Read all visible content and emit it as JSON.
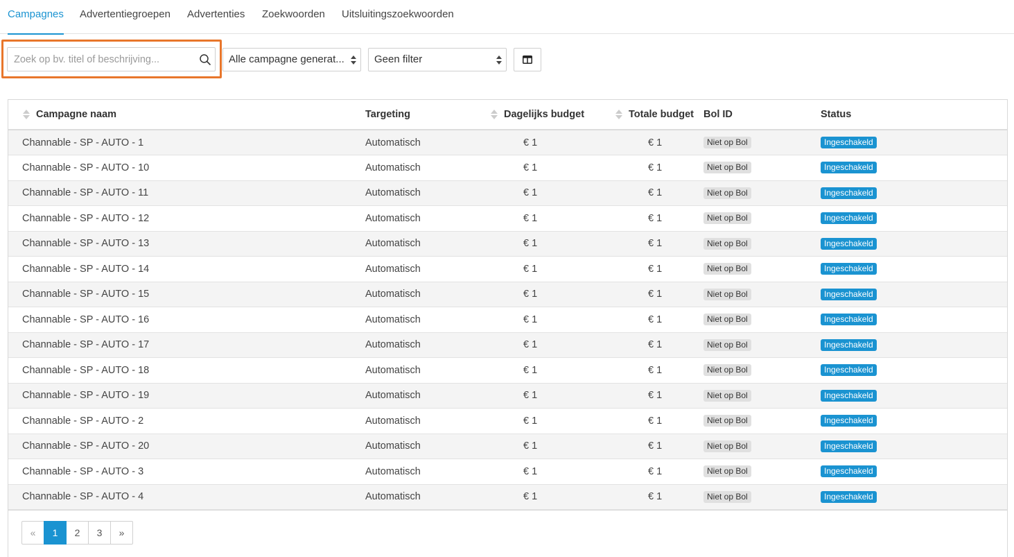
{
  "tabs": [
    {
      "label": "Campagnes",
      "active": true
    },
    {
      "label": "Advertentiegroepen"
    },
    {
      "label": "Advertenties"
    },
    {
      "label": "Zoekwoorden"
    },
    {
      "label": "Uitsluitingszoekwoorden"
    }
  ],
  "toolbar": {
    "search_placeholder": "Zoek op bv. titel of beschrijving...",
    "generator_select": "Alle campagne generat...",
    "filter_select": "Geen filter"
  },
  "table": {
    "columns": [
      "Campagne naam",
      "Targeting",
      "Dagelijks budget",
      "Totale budget",
      "Bol ID",
      "Status"
    ],
    "rows": [
      {
        "name": "Channable - SP - AUTO - 1",
        "targeting": "Automatisch",
        "daily": "€ 1",
        "total": "€ 1",
        "bol": "Niet op Bol",
        "status": "Ingeschakeld"
      },
      {
        "name": "Channable - SP - AUTO - 10",
        "targeting": "Automatisch",
        "daily": "€ 1",
        "total": "€ 1",
        "bol": "Niet op Bol",
        "status": "Ingeschakeld"
      },
      {
        "name": "Channable - SP - AUTO - 11",
        "targeting": "Automatisch",
        "daily": "€ 1",
        "total": "€ 1",
        "bol": "Niet op Bol",
        "status": "Ingeschakeld"
      },
      {
        "name": "Channable - SP - AUTO - 12",
        "targeting": "Automatisch",
        "daily": "€ 1",
        "total": "€ 1",
        "bol": "Niet op Bol",
        "status": "Ingeschakeld"
      },
      {
        "name": "Channable - SP - AUTO - 13",
        "targeting": "Automatisch",
        "daily": "€ 1",
        "total": "€ 1",
        "bol": "Niet op Bol",
        "status": "Ingeschakeld"
      },
      {
        "name": "Channable - SP - AUTO - 14",
        "targeting": "Automatisch",
        "daily": "€ 1",
        "total": "€ 1",
        "bol": "Niet op Bol",
        "status": "Ingeschakeld"
      },
      {
        "name": "Channable - SP - AUTO - 15",
        "targeting": "Automatisch",
        "daily": "€ 1",
        "total": "€ 1",
        "bol": "Niet op Bol",
        "status": "Ingeschakeld"
      },
      {
        "name": "Channable - SP - AUTO - 16",
        "targeting": "Automatisch",
        "daily": "€ 1",
        "total": "€ 1",
        "bol": "Niet op Bol",
        "status": "Ingeschakeld"
      },
      {
        "name": "Channable - SP - AUTO - 17",
        "targeting": "Automatisch",
        "daily": "€ 1",
        "total": "€ 1",
        "bol": "Niet op Bol",
        "status": "Ingeschakeld"
      },
      {
        "name": "Channable - SP - AUTO - 18",
        "targeting": "Automatisch",
        "daily": "€ 1",
        "total": "€ 1",
        "bol": "Niet op Bol",
        "status": "Ingeschakeld"
      },
      {
        "name": "Channable - SP - AUTO - 19",
        "targeting": "Automatisch",
        "daily": "€ 1",
        "total": "€ 1",
        "bol": "Niet op Bol",
        "status": "Ingeschakeld"
      },
      {
        "name": "Channable - SP - AUTO - 2",
        "targeting": "Automatisch",
        "daily": "€ 1",
        "total": "€ 1",
        "bol": "Niet op Bol",
        "status": "Ingeschakeld"
      },
      {
        "name": "Channable - SP - AUTO - 20",
        "targeting": "Automatisch",
        "daily": "€ 1",
        "total": "€ 1",
        "bol": "Niet op Bol",
        "status": "Ingeschakeld"
      },
      {
        "name": "Channable - SP - AUTO - 3",
        "targeting": "Automatisch",
        "daily": "€ 1",
        "total": "€ 1",
        "bol": "Niet op Bol",
        "status": "Ingeschakeld"
      },
      {
        "name": "Channable - SP - AUTO - 4",
        "targeting": "Automatisch",
        "daily": "€ 1",
        "total": "€ 1",
        "bol": "Niet op Bol",
        "status": "Ingeschakeld"
      }
    ]
  },
  "pagination": {
    "prev": "«",
    "pages": [
      "1",
      "2",
      "3"
    ],
    "active_page": "1",
    "next": "»"
  },
  "colors": {
    "accent": "#1a93d1",
    "highlight": "#e8762b"
  },
  "icons": {
    "search": "search-icon",
    "select_arrow": "sort-arrows-icon",
    "columns": "columns-icon",
    "sort": "sort-icon"
  }
}
